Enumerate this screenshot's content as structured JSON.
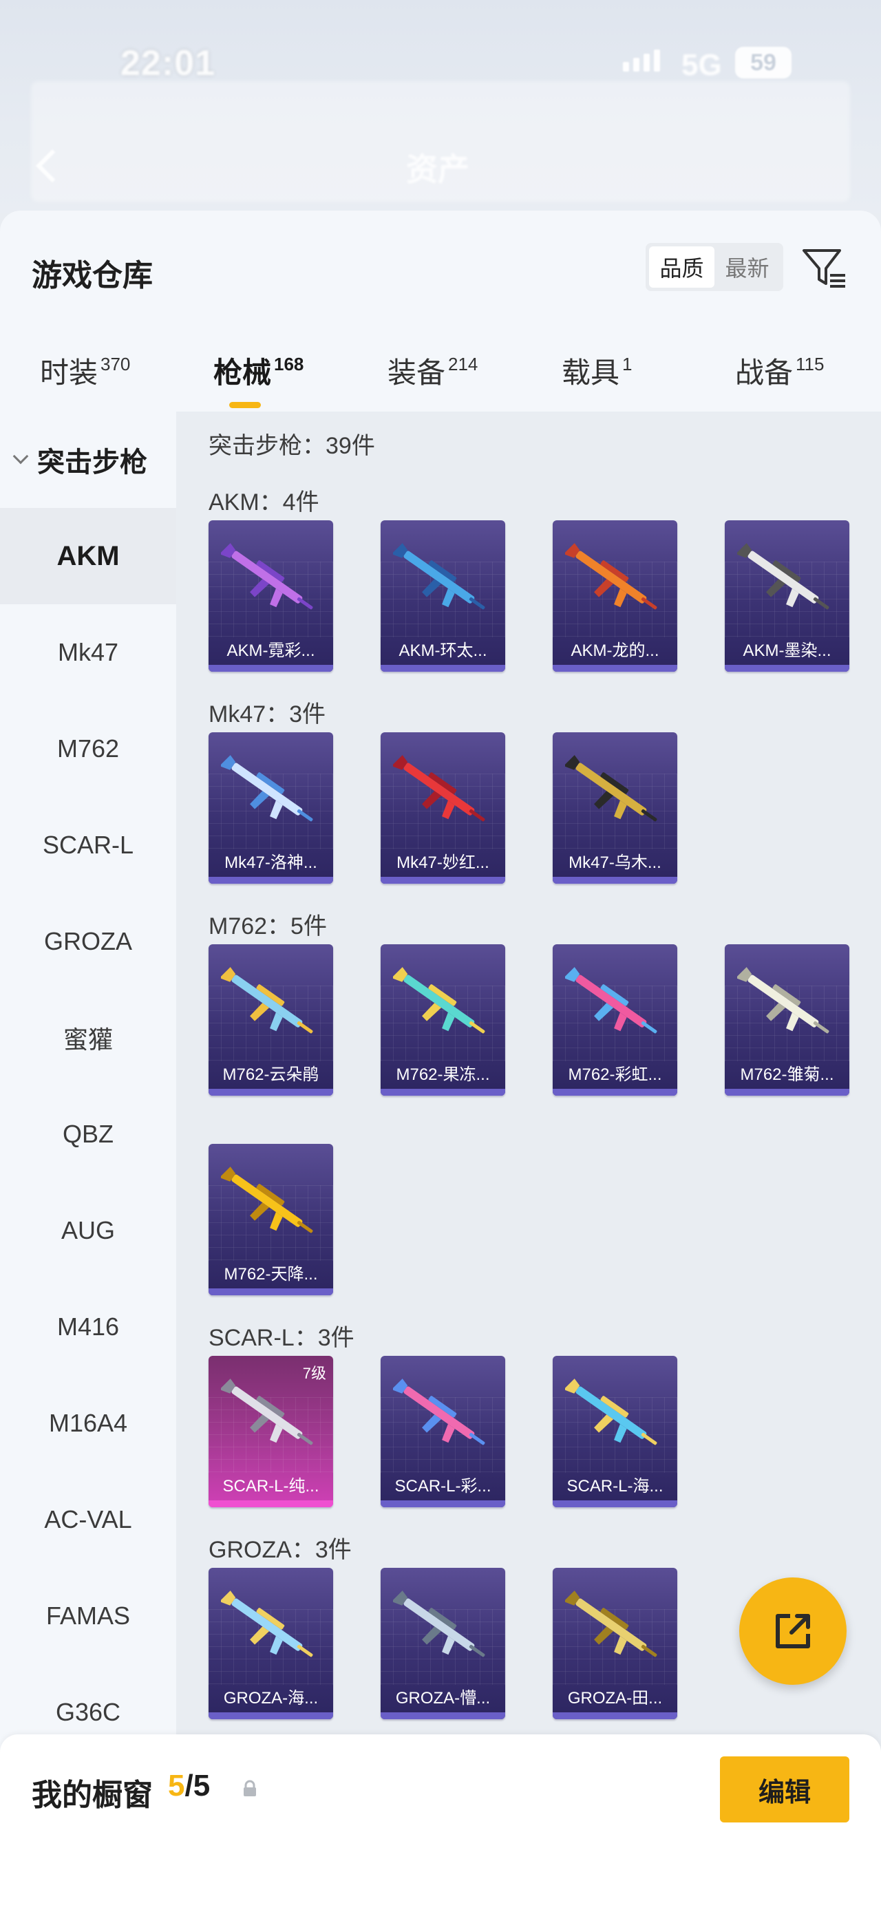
{
  "status_bar": {
    "time": "22:01",
    "network": "5G",
    "battery": "59"
  },
  "header": {
    "blurred_title": "资产"
  },
  "sheet": {
    "title": "游戏仓库",
    "sort": {
      "options": [
        "品质",
        "最新"
      ],
      "selected": "品质"
    }
  },
  "tabs": [
    {
      "label": "时装",
      "count": "370"
    },
    {
      "label": "枪械",
      "count": "168"
    },
    {
      "label": "装备",
      "count": "214"
    },
    {
      "label": "载具",
      "count": "1"
    },
    {
      "label": "战备",
      "count": "115"
    }
  ],
  "active_tab": "枪械",
  "sidebar": {
    "category": "突击步枪",
    "items": [
      "AKM",
      "Mk47",
      "M762",
      "SCAR-L",
      "GROZA",
      "蜜獾",
      "QBZ",
      "AUG",
      "M416",
      "M16A4",
      "AC-VAL",
      "FAMAS",
      "G36C"
    ],
    "active": "AKM"
  },
  "main": {
    "total_label": "突击步枪：39件",
    "groups": [
      {
        "label": "AKM：4件",
        "items": [
          "AKM-霓彩...",
          "AKM-环太...",
          "AKM-龙的...",
          "AKM-墨染..."
        ]
      },
      {
        "label": "Mk47：3件",
        "items": [
          "Mk47-洛神...",
          "Mk47-妙红...",
          "Mk47-乌木..."
        ]
      },
      {
        "label": "M762：5件",
        "items": [
          "M762-云朵鹃",
          "M762-果冻...",
          "M762-彩虹...",
          "M762-雏菊...",
          "M762-天降..."
        ]
      },
      {
        "label": "SCAR-L：3件",
        "items": [
          "SCAR-L-纯...",
          "SCAR-L-彩...",
          "SCAR-L-海..."
        ],
        "level_badge": "7级"
      },
      {
        "label": "GROZA：3件",
        "items": [
          "GROZA-海...",
          "GROZA-懵...",
          "GROZA-田..."
        ]
      }
    ]
  },
  "showcase": {
    "label": "我的橱窗",
    "current": "5",
    "total": "/5",
    "edit_label": "编辑"
  },
  "colors": {
    "accent": "#f7b614",
    "card_purple": "#3b3273",
    "card_legend": "#d040b6"
  },
  "icons": {
    "filter": "filter-icon",
    "share": "share-icon",
    "lock": "lock-icon",
    "back": "back-arrow-icon"
  }
}
